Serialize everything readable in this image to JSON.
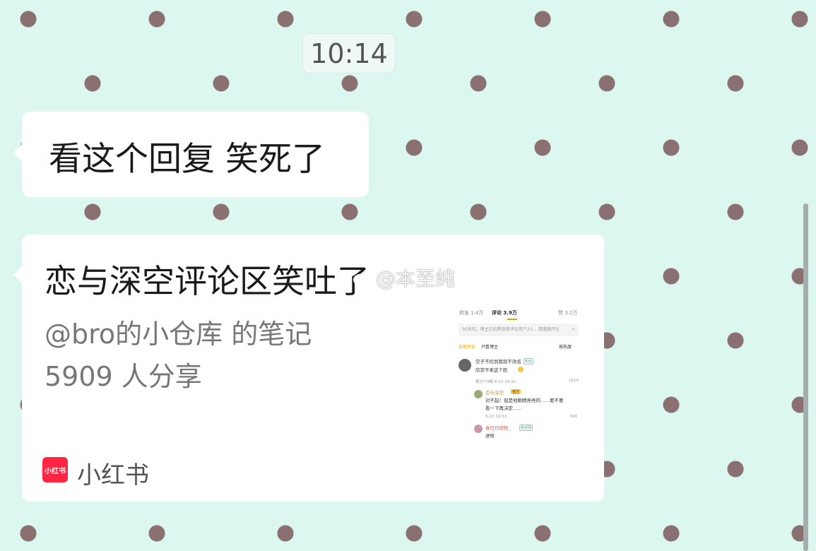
{
  "timestamp": "10:14",
  "messages": [
    {
      "text": "看这个回复 笑死了"
    }
  ],
  "card": {
    "title": "恋与深空评论区笑吐了",
    "author": "@bro的小仓库 的笔记",
    "shares": "5909 人分享",
    "source": "小红书",
    "source_logo_text": "小红书",
    "thumbnail": {
      "tabs": [
        "转发 1.4万",
        "评论 3.9万",
        "赞 3.2万"
      ],
      "notice": "30天内，博主已拉黑恶意评论用户3人，请谨慎评论",
      "notice_close": "×",
      "filters": [
        "全部评论",
        "只看博主",
        "按热度"
      ],
      "comments": [
        {
          "name": "空子不捡到我就不改名",
          "tag": "粉丝",
          "text": "欣赏不来这个脸",
          "meta": "第2774楼  6-22 18:32"
        },
        {
          "name": "恋与深空",
          "badge": "官方",
          "text1": "对不起！但是他眼睛亮亮的……要不要",
          "text2": "看一下再决定……",
          "meta": "6-22 19:33",
          "likes": "500"
        },
        {
          "name": "春日玛德牧_",
          "tag": "粉丝团",
          "text": "进哈"
        }
      ],
      "likes_first": "1619"
    }
  },
  "watermark": "@本至纯",
  "colors": {
    "background": "#dcf7ef",
    "dot": "#8a7070",
    "bubble": "#ffffff",
    "xiaohongshu_red": "#ff2442"
  }
}
